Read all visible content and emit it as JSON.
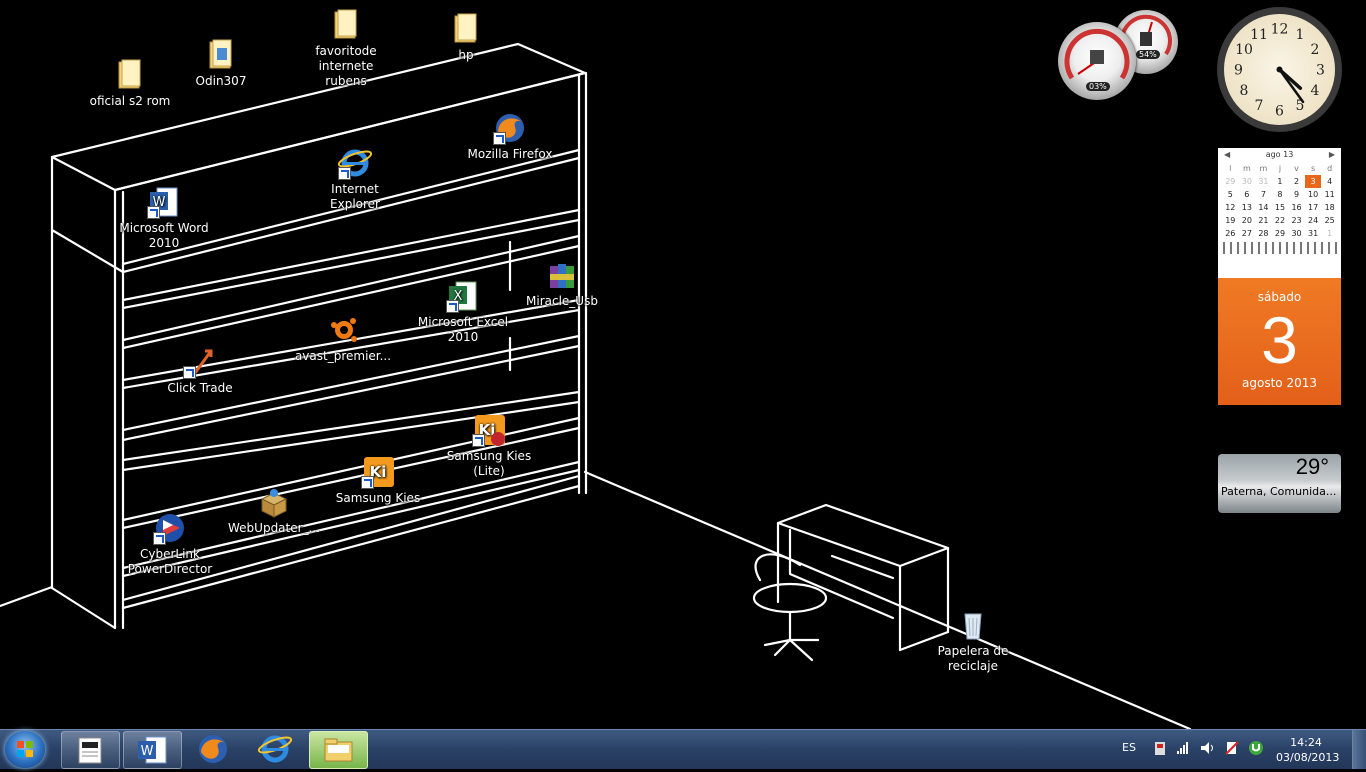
{
  "desktop": {
    "icons": [
      {
        "label": "oficial s2 rom"
      },
      {
        "label": "Odin307"
      },
      {
        "label": "favoritode internete rubens"
      },
      {
        "label": "hp"
      },
      {
        "label": "Mozilla Firefox"
      },
      {
        "label": "Internet Explorer"
      },
      {
        "label": "Microsoft Word 2010"
      },
      {
        "label": "Miracle_Usb"
      },
      {
        "label": "Microsoft Excel 2010"
      },
      {
        "label": "avast_premier..."
      },
      {
        "label": "Click Trade"
      },
      {
        "label": "Samsung Kies (Lite)"
      },
      {
        "label": "Samsung Kies"
      },
      {
        "label": "WebUpdater_..."
      },
      {
        "label": "CyberLink PowerDirector"
      },
      {
        "label": "Papelera de reciclaje"
      }
    ]
  },
  "gadgets": {
    "cpu_meter": {
      "cpu": "03%",
      "memory": "54%"
    },
    "calendar": {
      "month_header": "ago 13",
      "weekdays": [
        "l",
        "m",
        "m",
        "j",
        "v",
        "s",
        "d"
      ],
      "weeks": [
        [
          "29",
          "30",
          "31",
          "1",
          "2",
          "3",
          "4"
        ],
        [
          "5",
          "6",
          "7",
          "8",
          "9",
          "10",
          "11"
        ],
        [
          "12",
          "13",
          "14",
          "15",
          "16",
          "17",
          "18"
        ],
        [
          "19",
          "20",
          "21",
          "22",
          "23",
          "24",
          "25"
        ],
        [
          "26",
          "27",
          "28",
          "29",
          "30",
          "31",
          "1"
        ]
      ],
      "day_name": "sábado",
      "day_number": "3",
      "month_year": "agosto 2013",
      "accent": "#e8671b"
    },
    "weather": {
      "temperature": "29°",
      "location": "Paterna, Comunida..."
    },
    "clock": {
      "hour": 4,
      "minute": 24,
      "numerals": [
        "12",
        "1",
        "2",
        "3",
        "4",
        "5",
        "6",
        "7",
        "8",
        "9",
        "10",
        "11"
      ]
    }
  },
  "taskbar": {
    "pinned": [
      {
        "name": "explorer-files",
        "icon": "document-icon"
      },
      {
        "name": "word",
        "icon": "word-icon"
      },
      {
        "name": "firefox",
        "icon": "firefox-icon"
      },
      {
        "name": "internet-explorer",
        "icon": "ie-icon"
      },
      {
        "name": "windows-explorer",
        "icon": "folder-icon"
      }
    ],
    "language": "ES",
    "time": "14:24",
    "date": "03/08/2013"
  }
}
